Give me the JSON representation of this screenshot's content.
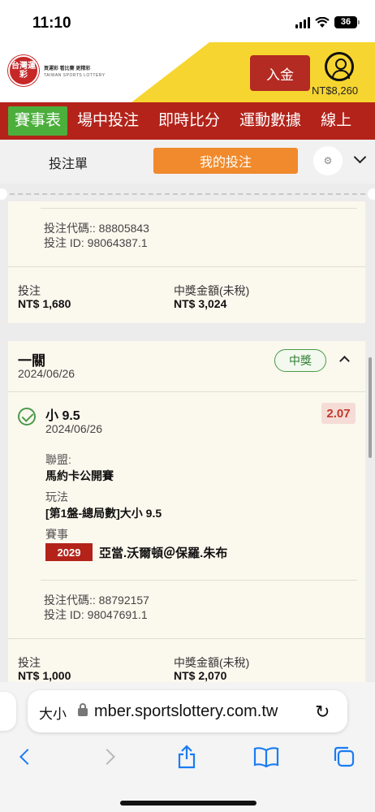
{
  "status_bar": {
    "time": "11:10",
    "battery": "36"
  },
  "header": {
    "logo_mark": "台灣運彩",
    "logo_slogan": "買運彩 看比賽 更精彩",
    "logo_en": "TAIWAN SPORTS LOTTERY",
    "deposit_label": "入金",
    "balance": "NT$8,260",
    "accent_color": "#b3231a",
    "yellow_color": "#f7d530"
  },
  "nav": {
    "items": [
      "賽事表",
      "場中投注",
      "即時比分",
      "運動數據",
      "線上"
    ]
  },
  "tabs": {
    "bet_slip": "投注單",
    "my_bets": "我的投注"
  },
  "bet1": {
    "code": "投注代碼:: 88805843",
    "id": "投注 ID: 98064387.1",
    "stake_label": "投注",
    "stake_value": "NT$ 1,680",
    "payout_label": "中獎金額(未稅)",
    "payout_value": "NT$ 3,024"
  },
  "bet2": {
    "title": "一關",
    "date": "2024/06/26",
    "status": "中獎",
    "selection": {
      "name": "小 9.5",
      "date": "2024/06/26",
      "odds": "2.07",
      "league_label": "聯盟:",
      "league": "馬約卡公開賽",
      "market_label": "玩法",
      "market": "[第1盤-總局數]大小 9.5",
      "event_label": "賽事",
      "event_no": "2029",
      "event_name": "亞當.沃爾頓＠保羅.朱布"
    },
    "code": "投注代碼:: 88792157",
    "id": "投注 ID: 98047691.1",
    "stake_label": "投注",
    "stake_value": "NT$ 1,000",
    "payout_label": "中獎金額(未稅)",
    "payout_value": "NT$ 2,070"
  },
  "browser": {
    "text_size": "大小",
    "url": "mber.sportslottery.com.tw"
  }
}
